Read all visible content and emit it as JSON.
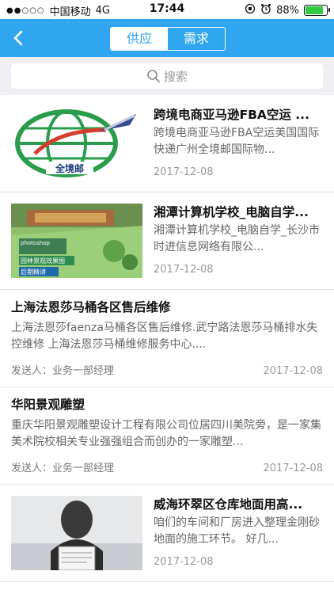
{
  "status": {
    "carrier": "中国移动",
    "network": "4G",
    "time": "17:44",
    "battery": "88%",
    "signal_dots": "●●○○○"
  },
  "nav": {
    "tabs": [
      "供应",
      "需求"
    ],
    "active_tab": "需求",
    "back_icon": "chevron-left-icon"
  },
  "search": {
    "placeholder": "搜索"
  },
  "items": [
    {
      "title": "跨境电商亚马逊FBA空运 ...",
      "desc": "跨境电商亚马逊FBA空运美国国际快递广州全境邮国际物...",
      "date": "2017-12-08",
      "logo_text": "全境邮"
    },
    {
      "title": "湘潭计算机学校_电脑自学...",
      "desc": "湘潭计算机学校_电脑自学_长沙市时进信息网络有限公...",
      "date": "2017-12-08",
      "image_text_top": "photoshop",
      "image_text_a": "园林景观效果图",
      "image_text_b": "后期精讲"
    },
    {
      "title": "上海法恩莎马桶各区售后维修",
      "desc": "上海法恩莎faenza马桶各区售后维修.武宁路法恩莎马桶排水失控维修      上海法恩莎马桶维修服务中心....",
      "sender": "发送人：业务一部经理",
      "date": "2017-12-08"
    },
    {
      "title": "华阳景观雕塑",
      "desc": "重庆华阳景观雕塑设计工程有限公司位居四川美院旁，是一家集美术院校相关专业强强组合而创办的一家雕塑...",
      "sender": "发送人：业务一部经理",
      "date": "2017-12-08"
    },
    {
      "title": "威海环翠区仓库地面用高...",
      "desc": "咱们的车间和厂房进入整理金刚砂地面的施工环节。 好几...",
      "date": "2017-12-08"
    }
  ]
}
